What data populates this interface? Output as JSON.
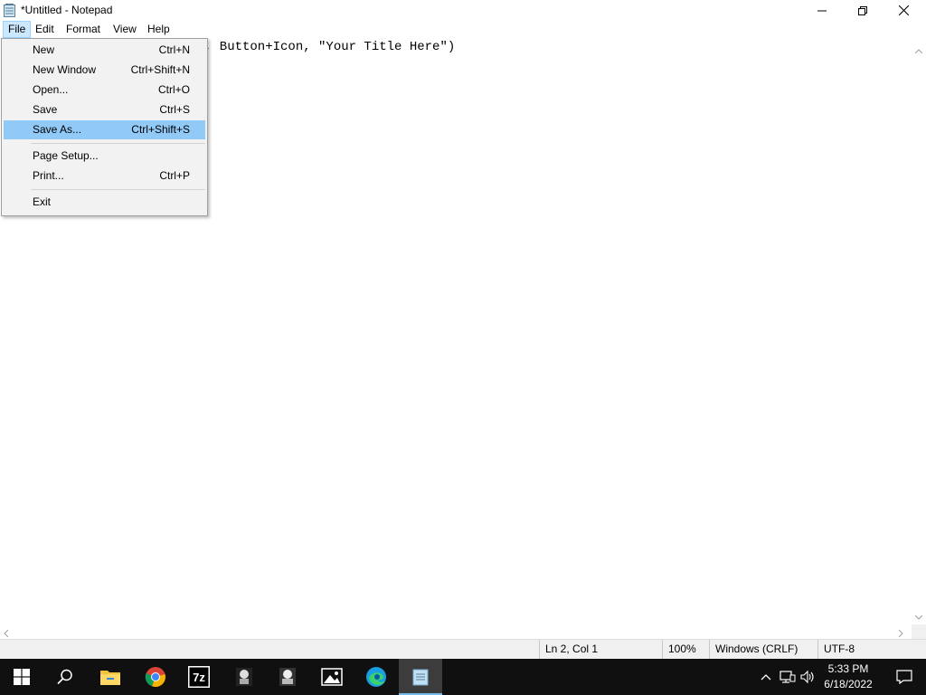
{
  "window": {
    "title": "*Untitled - Notepad"
  },
  "menubar": {
    "items": [
      {
        "label": "File"
      },
      {
        "label": "Edit"
      },
      {
        "label": "Format"
      },
      {
        "label": "View"
      },
      {
        "label": "Help"
      }
    ]
  },
  "editor": {
    "visible_text": ", Button+Icon, \"Your Title Here\")"
  },
  "file_menu": {
    "items": [
      {
        "label": "New",
        "shortcut": "Ctrl+N"
      },
      {
        "label": "New Window",
        "shortcut": "Ctrl+Shift+N"
      },
      {
        "label": "Open...",
        "shortcut": "Ctrl+O"
      },
      {
        "label": "Save",
        "shortcut": "Ctrl+S"
      },
      {
        "label": "Save As...",
        "shortcut": "Ctrl+Shift+S",
        "highlighted": true
      },
      {
        "label": "Page Setup...",
        "shortcut": ""
      },
      {
        "label": "Print...",
        "shortcut": "Ctrl+P"
      },
      {
        "label": "Exit",
        "shortcut": ""
      }
    ]
  },
  "statusbar": {
    "position": "Ln 2, Col 1",
    "zoom": "100%",
    "line_ending": "Windows (CRLF)",
    "encoding": "UTF-8"
  },
  "taskbar": {
    "apps": [
      "start-icon",
      "search-icon",
      "file-explorer-icon",
      "chrome-icon",
      "7zip-icon",
      "app-icon-1",
      "app-icon-2",
      "photos-icon",
      "edge-icon",
      "notepad-icon"
    ],
    "active_app": "notepad-icon",
    "time": "5:33 PM",
    "date": "6/18/2022"
  },
  "colors": {
    "menu_highlight": "#91c9f7",
    "menu_active": "#cce8ff",
    "taskbar": "#101010",
    "statusbar": "#f0f0f0"
  }
}
